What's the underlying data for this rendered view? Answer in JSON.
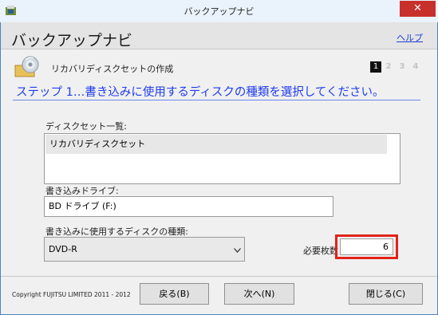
{
  "window": {
    "title": "バックアップナビ",
    "close_glyph": "✕"
  },
  "header": {
    "title": "バックアップナビ",
    "help_link": "ヘルプ"
  },
  "section": {
    "title": "リカバリディスクセットの作成"
  },
  "steps": [
    "1",
    "2",
    "3",
    "4"
  ],
  "active_step": "1",
  "step_heading": "ステップ 1…書き込みに使用するディスクの種類を選択してください。",
  "disc_set": {
    "label": "ディスクセット一覧:",
    "items": [
      "リカバリディスクセット"
    ]
  },
  "drive": {
    "label": "書き込みドライブ:",
    "value": "BD ドライブ (F:)"
  },
  "disc_type": {
    "label": "書き込みに使用するディスクの種類:",
    "selected": "DVD-R"
  },
  "required_count": {
    "label": "必要枚数",
    "value": "6"
  },
  "footer": {
    "copyright": "Copyright FUJITSU LIMITED 2011 - 2012",
    "back_button": "戻る(B)",
    "next_button": "次へ(N)",
    "close_button": "閉じる(C)"
  },
  "colors": {
    "accent": "#1e3bf0",
    "highlight": "#e2231a",
    "close": "#c7302b"
  },
  "icons": [
    "app-icon",
    "disc-folder-icon",
    "chevron-down-icon",
    "close-icon"
  ]
}
